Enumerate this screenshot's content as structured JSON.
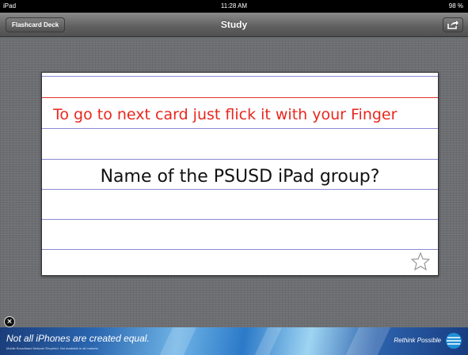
{
  "status_bar": {
    "device": "iPad",
    "time": "11:28 AM",
    "battery": "98 %"
  },
  "nav_bar": {
    "back_label": "Flashcard Deck",
    "title": "Study",
    "share_icon": "share-icon"
  },
  "card": {
    "hint": "To go to next card just flick it with your Finger",
    "question": "Name of the PSUSD iPad group?",
    "favorite_icon": "star-icon"
  },
  "ad": {
    "close_icon": "close-icon",
    "headline": "Not all iPhones are created equal.",
    "fine_print": "Mobile Broadband Network Required. Not available in all markets.",
    "brand_tagline": "Rethink Possible",
    "brand_logo": "att-globe-logo"
  },
  "colors": {
    "hint_red": "#e8271e",
    "ruled_line_blue": "#8a8ad8",
    "background_gray": "#6c6e72"
  }
}
